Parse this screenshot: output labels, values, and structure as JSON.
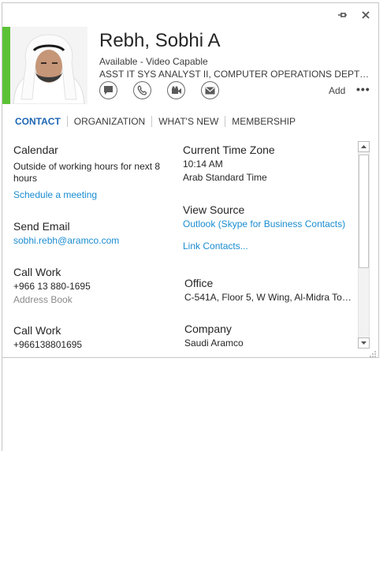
{
  "window": {
    "pin_icon": "pin-icon",
    "close_icon": "close-icon"
  },
  "contact": {
    "name": "Rebh, Sobhi A",
    "status": "Available - Video Capable",
    "title": "ASST IT SYS ANALYST II, COMPUTER OPERATIONS DEPT / MO…",
    "presence_color": "#5bc236"
  },
  "actions": {
    "icons": [
      "chat-icon",
      "phone-icon",
      "video-icon",
      "email-icon"
    ],
    "add_label": "Add",
    "more_label": "•••"
  },
  "tabs": [
    "CONTACT",
    "ORGANIZATION",
    "WHAT'S NEW",
    "MEMBERSHIP"
  ],
  "fields": {
    "calendar": {
      "label": "Calendar",
      "value": "Outside of working hours for next 8 hours",
      "link": "Schedule a meeting"
    },
    "send_email": {
      "label": "Send Email",
      "value": "sobhi.rebh@aramco.com"
    },
    "call_work_1": {
      "label": "Call Work",
      "value": "+966 13 880-1695",
      "sub": "Address Book"
    },
    "call_work_2": {
      "label": "Call Work",
      "value": "+966138801695"
    },
    "time_zone": {
      "label": "Current Time Zone",
      "time": "10:14 AM",
      "zone": "Arab Standard Time"
    },
    "view_source": {
      "label": "View Source",
      "value": "Outlook (Skype for Business Contacts)",
      "link": "Link Contacts..."
    },
    "office": {
      "label": "Office",
      "value": "C-541A,  Floor 5, W Wing,  Al-Midra To…"
    },
    "company": {
      "label": "Company",
      "value": "Saudi Aramco"
    }
  },
  "colors": {
    "accent": "#1e66b5",
    "link": "#1a8cd1",
    "presence": "#5bc236"
  }
}
